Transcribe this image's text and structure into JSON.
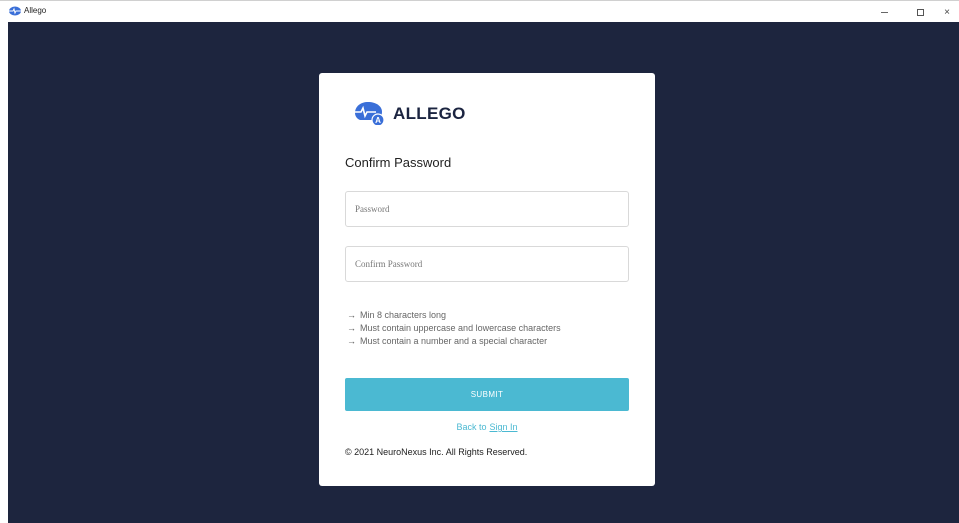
{
  "window": {
    "title": "Allego",
    "minimize_icon": "minimize-icon",
    "maximize_icon": "maximize-icon",
    "close_icon": "close-icon",
    "close_glyph": "×"
  },
  "brand": {
    "name": "ALLEGO",
    "logo_icon": "allego-logo-icon",
    "logo_color": "#3a6fd8"
  },
  "form": {
    "title": "Confirm Password",
    "password_placeholder": "Password",
    "password_value": "",
    "confirm_placeholder": "Confirm Password",
    "confirm_value": "",
    "rules": [
      "Min 8 characters long",
      "Must contain uppercase and lowercase characters",
      "Must contain a number and a special character"
    ],
    "rule_arrow": "→",
    "submit_label": "SUBMIT",
    "back_prefix": "Back to",
    "back_link": "Sign In"
  },
  "footer": {
    "copyright": "© 2021 NeuroNexus Inc. All Rights Reserved."
  },
  "colors": {
    "background": "#1d253e",
    "card": "#ffffff",
    "accent": "#4bb9d2",
    "brand_text": "#1b2440"
  }
}
